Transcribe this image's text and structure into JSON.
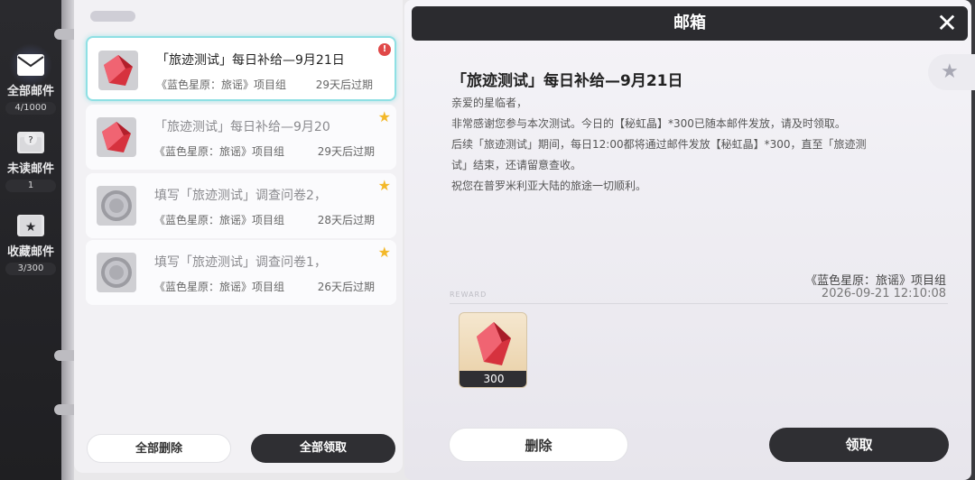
{
  "nav": {
    "items": [
      {
        "label": "全部邮件",
        "count": "4/1000",
        "icon": "envelope-icon"
      },
      {
        "label": "未读邮件",
        "count": "1",
        "icon": "unread-mail-icon"
      },
      {
        "label": "收藏邮件",
        "count": "3/300",
        "icon": "star-box-icon"
      }
    ]
  },
  "list": {
    "mails": [
      {
        "title": "「旅迹测试」每日补给—9月21日",
        "sender": "《蓝色星原：旅谣》项目组",
        "expiry": "29天后过期",
        "thumb": "red-crystal",
        "marker": "unread"
      },
      {
        "title": "「旅迹测试」每日补给—9月20",
        "sender": "《蓝色星原：旅谣》项目组",
        "expiry": "29天后过期",
        "thumb": "red-crystal",
        "marker": "star"
      },
      {
        "title": "填写「旅迹测试」调查问卷2，",
        "sender": "《蓝色星原：旅谣》项目组",
        "expiry": "28天后过期",
        "thumb": "silver-coin",
        "marker": "star"
      },
      {
        "title": "填写「旅迹测试」调查问卷1，",
        "sender": "《蓝色星原：旅谣》项目组",
        "expiry": "26天后过期",
        "thumb": "silver-coin",
        "marker": "star"
      }
    ],
    "delete_all_label": "全部删除",
    "claim_all_label": "全部领取"
  },
  "detail": {
    "header_title": "邮箱",
    "close_symbol": "✕",
    "fav_symbol": "★",
    "heading": "「旅迹测试」每日补给—9月21日",
    "body": [
      "亲爱的星临者，",
      "非常感谢您参与本次测试。今日的【秘虹晶】*300已随本邮件发放，请及时领取。",
      "后续「旅迹测试」期间，每日12:00都将通过邮件发放【秘虹晶】*300，直至「旅迹测",
      "试」结束，还请留意查收。",
      "祝您在普罗米利亚大陆的旅途一切顺利。"
    ],
    "signature_team": "《蓝色星原：旅谣》项目组",
    "signature_date": "2026-09-21 12:10:08",
    "reward_label": "REWARD",
    "reward": {
      "item": "red-crystal",
      "quantity": "300"
    },
    "delete_label": "删除",
    "claim_label": "领取"
  },
  "colors": {
    "accent_border": "#8fe0e4",
    "star": "#f3b829",
    "unread_badge": "#e04848",
    "dark_button": "#2f2f33"
  }
}
